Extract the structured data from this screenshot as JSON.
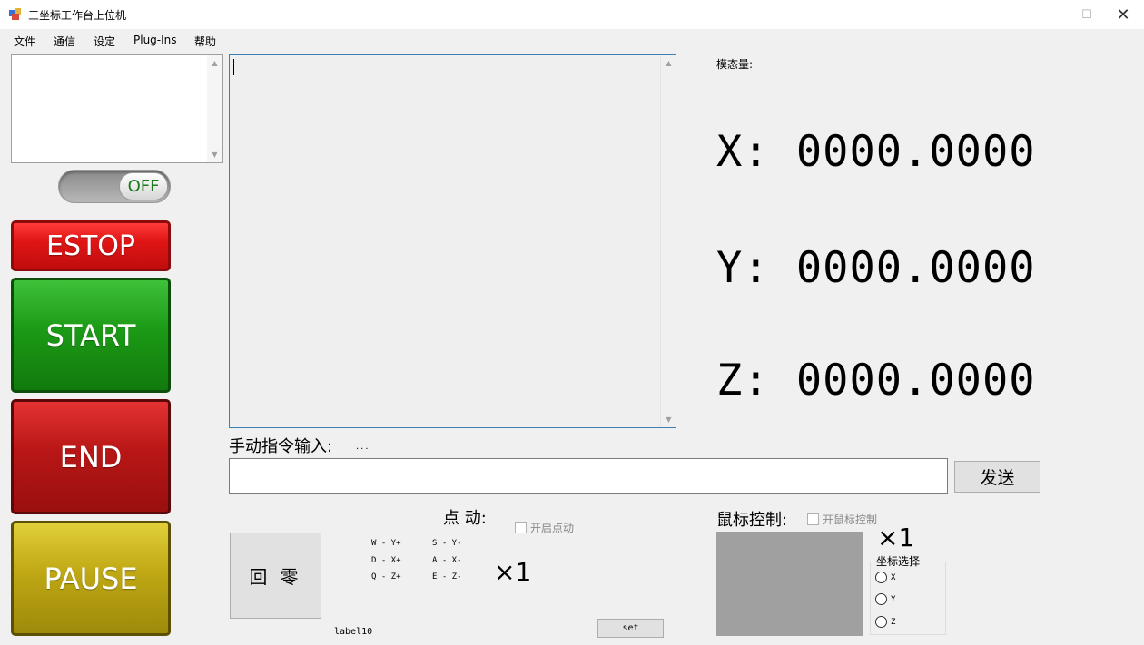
{
  "window": {
    "title": "三坐标工作台上位机",
    "minimize": "—",
    "maximize": "☐",
    "close": "✕"
  },
  "menu": [
    "文件",
    "通信",
    "设定",
    "Plug-Ins",
    "帮助"
  ],
  "toggle": {
    "label": "OFF",
    "state": "off"
  },
  "buttons": {
    "estop": "ESTOP",
    "start": "START",
    "end": "END",
    "pause": "PAUSE",
    "send": "发送",
    "home": "回 零",
    "set": "set"
  },
  "manual": {
    "label": "手动指令输入:",
    "hint": "...",
    "value": ""
  },
  "coords": {
    "modal_label": "模态量:",
    "x": "X: 0000.0000",
    "y": "Y: 0000.0000",
    "z": "Z: 0000.0000"
  },
  "jog": {
    "label": "点 动:",
    "enable_label": "开启点动",
    "keymap": [
      "W - Y+",
      "S - Y-",
      "D - X+",
      "A - X-",
      "Q - Z+",
      "E - Z-"
    ],
    "multiplier": "×1",
    "label10": "label10"
  },
  "mouse": {
    "label": "鼠标控制:",
    "enable_label": "开鼠标控制",
    "multiplier": "×1",
    "axis_title": "坐标选择",
    "axes": [
      "X",
      "Y",
      "Z"
    ]
  },
  "colors": {
    "estop": "#e01515",
    "start": "#1c9a16",
    "end": "#b81616",
    "pause": "#bfa814",
    "mouse_pad": "#a0a0a0"
  }
}
